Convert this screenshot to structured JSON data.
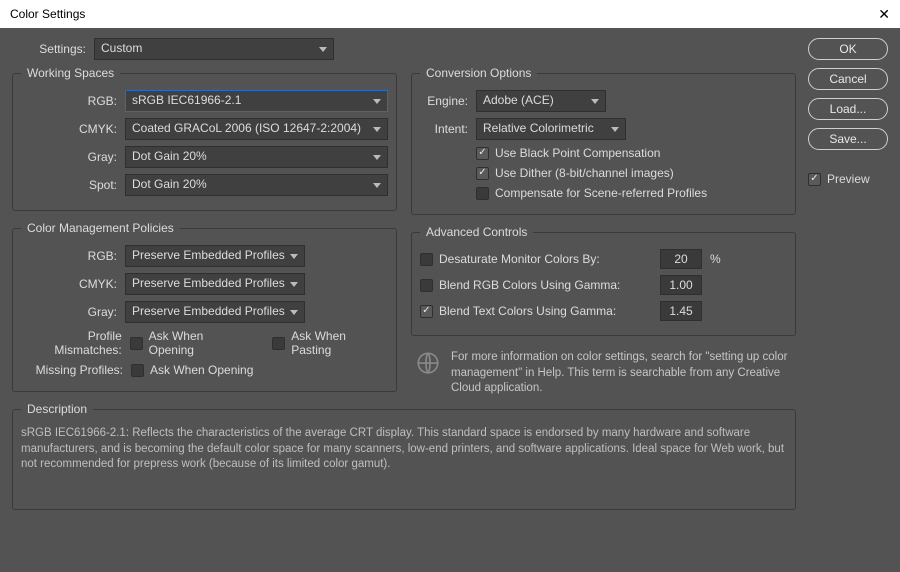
{
  "window": {
    "title": "Color Settings"
  },
  "settings": {
    "label": "Settings:",
    "value": "Custom"
  },
  "workingSpaces": {
    "legend": "Working Spaces",
    "rgb_label": "RGB:",
    "rgb_value": "sRGB IEC61966-2.1",
    "cmyk_label": "CMYK:",
    "cmyk_value": "Coated GRACoL 2006 (ISO 12647-2:2004)",
    "gray_label": "Gray:",
    "gray_value": "Dot Gain 20%",
    "spot_label": "Spot:",
    "spot_value": "Dot Gain 20%"
  },
  "policies": {
    "legend": "Color Management Policies",
    "rgb_label": "RGB:",
    "rgb_value": "Preserve Embedded Profiles",
    "cmyk_label": "CMYK:",
    "cmyk_value": "Preserve Embedded Profiles",
    "gray_label": "Gray:",
    "gray_value": "Preserve Embedded Profiles",
    "mismatch_label": "Profile Mismatches:",
    "mismatch_open": "Ask When Opening",
    "mismatch_paste": "Ask When Pasting",
    "missing_label": "Missing Profiles:",
    "missing_open": "Ask When Opening"
  },
  "conversion": {
    "legend": "Conversion Options",
    "engine_label": "Engine:",
    "engine_value": "Adobe (ACE)",
    "intent_label": "Intent:",
    "intent_value": "Relative Colorimetric",
    "bpc": "Use Black Point Compensation",
    "dither": "Use Dither (8-bit/channel images)",
    "compensate": "Compensate for Scene-referred Profiles"
  },
  "advanced": {
    "legend": "Advanced Controls",
    "desat_label": "Desaturate Monitor Colors By:",
    "desat_value": "20",
    "percent": "%",
    "blend_rgb_label": "Blend RGB Colors Using Gamma:",
    "blend_rgb_value": "1.00",
    "blend_text_label": "Blend Text Colors Using Gamma:",
    "blend_text_value": "1.45"
  },
  "info": {
    "text": "For more information on color settings, search for \"setting up color management\" in Help. This term is searchable from any Creative Cloud application."
  },
  "description": {
    "legend": "Description",
    "text": "sRGB IEC61966-2.1:  Reflects the characteristics of the average CRT display.  This standard space is endorsed by many hardware and software manufacturers, and is becoming the default color space for many scanners, low-end printers, and software applications.  Ideal space for Web work, but not recommended for prepress work (because of its limited color gamut)."
  },
  "buttons": {
    "ok": "OK",
    "cancel": "Cancel",
    "load": "Load...",
    "save": "Save...",
    "preview": "Preview"
  }
}
